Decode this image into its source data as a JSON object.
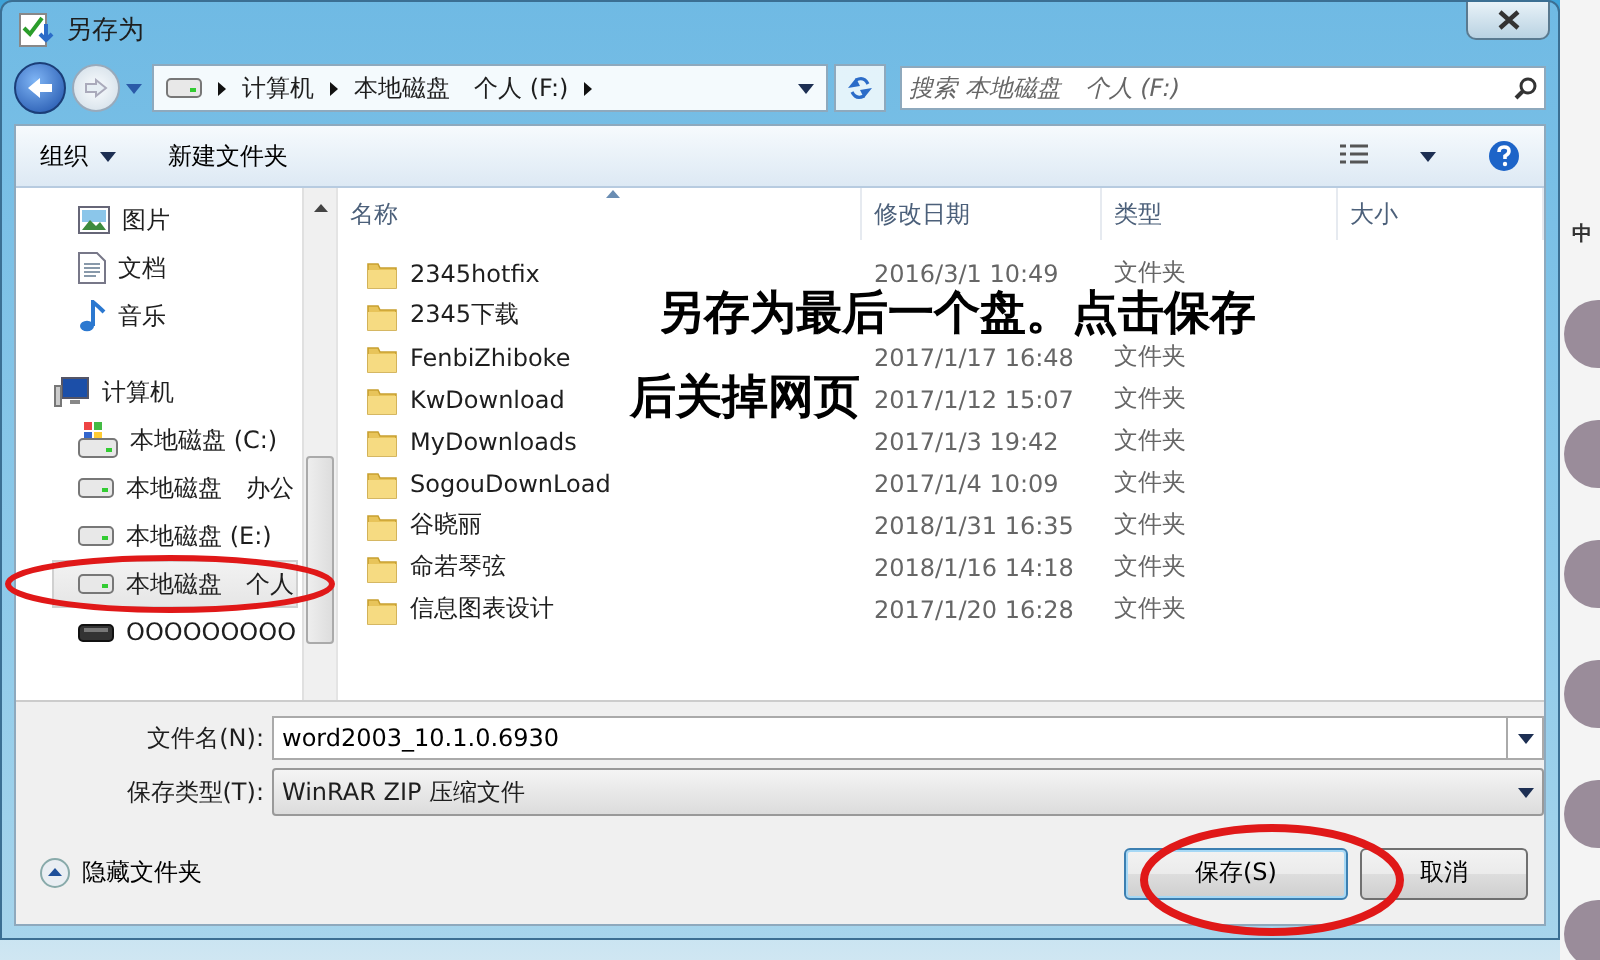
{
  "window": {
    "title": "另存为"
  },
  "address": {
    "crumbs": [
      "计算机",
      "本地磁盘　个人 (F:)"
    ]
  },
  "search": {
    "placeholder": "搜索 本地磁盘　个人 (F:)"
  },
  "toolbar": {
    "organize": "组织",
    "new_folder": "新建文件夹"
  },
  "sidebar": {
    "items": [
      {
        "label": "图片",
        "kind": "picture",
        "selected": false
      },
      {
        "label": "文档",
        "kind": "document",
        "selected": false
      },
      {
        "label": "音乐",
        "kind": "music",
        "selected": false
      },
      {
        "label": "计算机",
        "kind": "computer",
        "selected": false
      },
      {
        "label": "本地磁盘 (C:)",
        "kind": "system-drive",
        "selected": false
      },
      {
        "label": "本地磁盘　办公",
        "kind": "drive",
        "selected": false
      },
      {
        "label": "本地磁盘 (E:)",
        "kind": "drive",
        "selected": false
      },
      {
        "label": "本地磁盘　个人",
        "kind": "drive",
        "selected": true
      },
      {
        "label": "OOOOOOOOO",
        "kind": "removable",
        "selected": false
      }
    ]
  },
  "table": {
    "columns": [
      "名称",
      "修改日期",
      "类型",
      "大小"
    ],
    "rows": [
      {
        "name": "2345hotfix",
        "date": "2016/3/1 10:49",
        "type": "文件夹"
      },
      {
        "name": "2345下载"
      },
      {
        "name": "FenbiZhiboke",
        "date": "2017/1/17 16:48",
        "type": "文件夹"
      },
      {
        "name": "KwDownload",
        "date": "2017/1/12 15:07",
        "type": "文件夹"
      },
      {
        "name": "MyDownloads",
        "date": "2017/1/3 19:42",
        "type": "文件夹"
      },
      {
        "name": "SogouDownLoad",
        "date": "2017/1/4 10:09",
        "type": "文件夹"
      },
      {
        "name": "谷晓丽",
        "date": "2018/1/31 16:35",
        "type": "文件夹"
      },
      {
        "name": "命若琴弦",
        "date": "2018/1/16 14:18",
        "type": "文件夹"
      },
      {
        "name": "信息图表设计",
        "date": "2017/1/20 16:28",
        "type": "文件夹"
      }
    ]
  },
  "file_name": {
    "label": "文件名(N):",
    "value": "word2003_10.1.0.6930"
  },
  "file_type": {
    "label": "保存类型(T):",
    "value": "WinRAR ZIP 压缩文件"
  },
  "hide_folders": "隐藏文件夹",
  "buttons": [
    {
      "label": "保存(S)",
      "kind": "primary"
    },
    {
      "label": "取消",
      "kind": "cancel"
    }
  ],
  "annotation": {
    "lines": [
      "另存为最后一个盘。点击保存",
      "后关掉网页"
    ]
  },
  "background_page": {
    "text": "中"
  }
}
